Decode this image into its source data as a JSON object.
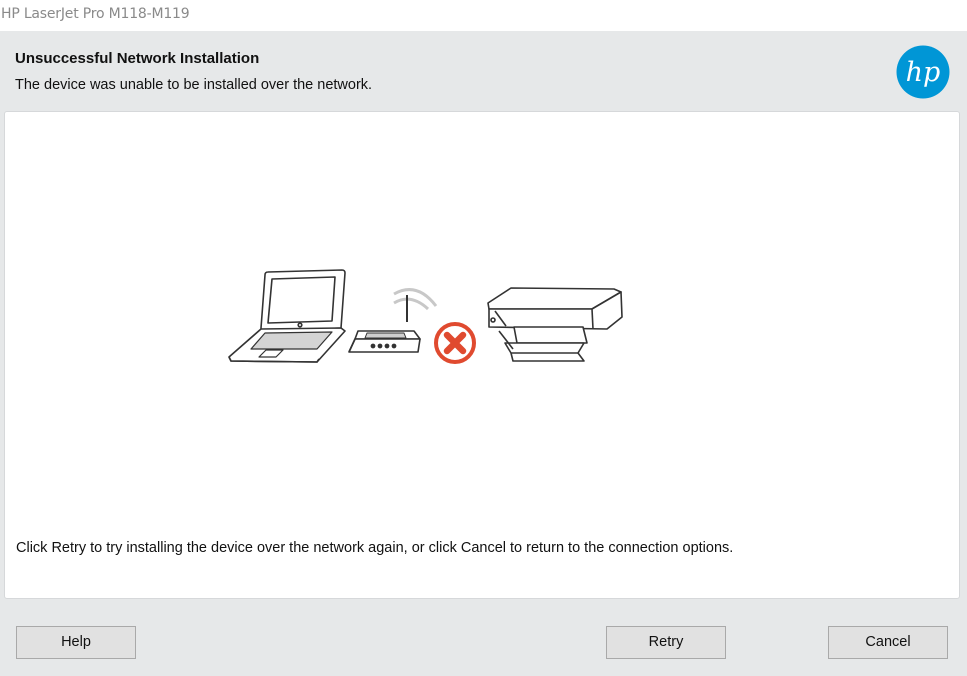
{
  "window": {
    "title": "HP LaserJet Pro M118-M119"
  },
  "header": {
    "heading": "Unsuccessful Network Installation",
    "subheading": "The device was unable to be installed over the network.",
    "logo_text": "hp",
    "logo_color": "#0096d6"
  },
  "main": {
    "illustration_icons": [
      "laptop-icon",
      "wireless-router-icon",
      "error-x-icon",
      "printer-icon"
    ],
    "error_color": "#e04a2f",
    "instruction": "Click Retry to try installing the device over the network again, or click Cancel to return to the connection options."
  },
  "buttons": {
    "help": "Help",
    "retry": "Retry",
    "cancel": "Cancel"
  }
}
